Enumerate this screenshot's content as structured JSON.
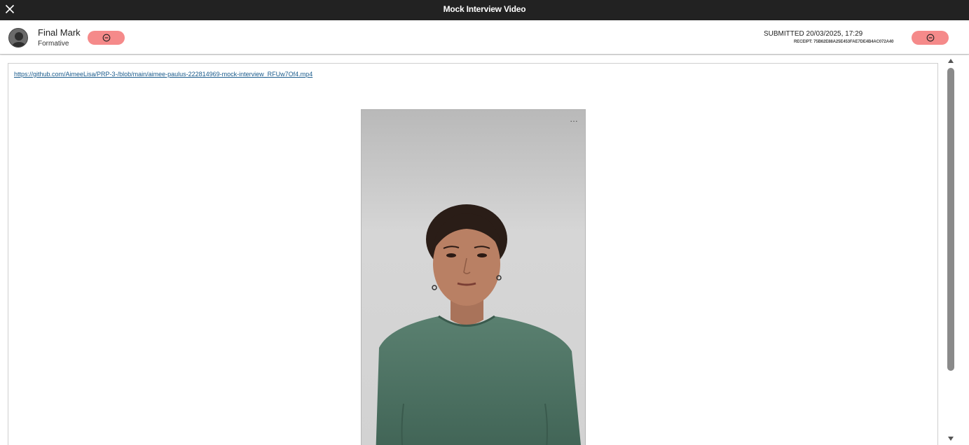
{
  "window": {
    "title": "Mock Interview Video",
    "close_icon": "close-icon"
  },
  "header": {
    "mark_title": "Final Mark",
    "mark_subtitle": "Formative",
    "submitted": "SUBMITTED 20/03/2025, 17:29",
    "receipt": "RECEIPT: 75B62E88A25E453FAE7DE4B4AC072A40",
    "pill_icon": "minus-circle-icon",
    "pill_color": "#f58a8a"
  },
  "content": {
    "link_text": "https://github.com/AimeeLisa/PRP-3-/blob/main/aimee-paulus-222814969-mock-interview_RFUw7Of4.mp4",
    "video_menu": "…"
  },
  "colors": {
    "titlebar": "#222222",
    "link": "#1a5b8c",
    "scroll_thumb": "#8a8a8a"
  }
}
